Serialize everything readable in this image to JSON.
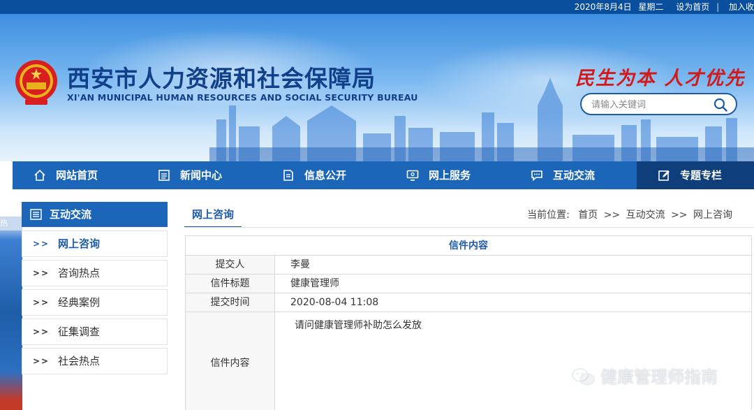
{
  "topbar": {
    "date": "2020年8月4日",
    "weekday": "星期二",
    "set_home": "设为首页",
    "separator": "|",
    "add_fav": "加入收"
  },
  "header": {
    "title": "西安市人力资源和社会保障局",
    "subtitle": "XI'AN MUNICIPAL HUMAN RESOURCES AND SOCIAL SECURITY BUREAU",
    "slogan": "民生为本 人才优先",
    "search_placeholder": "请输入关键词",
    "emblem_icon": "national-emblem-icon",
    "search_icon": "search-icon"
  },
  "nav": {
    "items": [
      {
        "label": "网站首页",
        "icon": "home-icon"
      },
      {
        "label": "新闻中心",
        "icon": "news-icon"
      },
      {
        "label": "信息公开",
        "icon": "document-icon"
      },
      {
        "label": "网上服务",
        "icon": "monitor-icon"
      },
      {
        "label": "互动交流",
        "icon": "chat-icon"
      },
      {
        "label": "专题专栏",
        "icon": "edit-icon"
      }
    ],
    "active_index": 5
  },
  "leftpic": {
    "caption": "热"
  },
  "sidebar": {
    "title": "互动交流",
    "chevron": ">>",
    "items": [
      {
        "label": "网上咨询"
      },
      {
        "label": "咨询热点"
      },
      {
        "label": "经典案例"
      },
      {
        "label": "征集调查"
      },
      {
        "label": "社会热点"
      }
    ],
    "active_index": 0
  },
  "content": {
    "tab": "网上咨询",
    "breadcrumb": {
      "prefix": "当前位置:",
      "home": "首页",
      "sep": ">>",
      "level1": "互动交流",
      "level2": "网上咨询"
    },
    "letter": {
      "title": "信件内容",
      "rows": [
        {
          "key": "提交人",
          "value": "李曼"
        },
        {
          "key": "信件标题",
          "value": "健康管理师"
        },
        {
          "key": "提交时间",
          "value": "2020-08-04 11:08"
        },
        {
          "key": "信件内容",
          "value": "请问健康管理师补助怎么发放"
        }
      ]
    }
  },
  "watermark": {
    "text": "健康管理师指南",
    "icon": "wechat-icon"
  },
  "colors": {
    "primary": "#1b66b8",
    "nav_active": "#0f3f7b",
    "slogan_red": "#d21a1a",
    "title_blue": "#123f8a"
  }
}
